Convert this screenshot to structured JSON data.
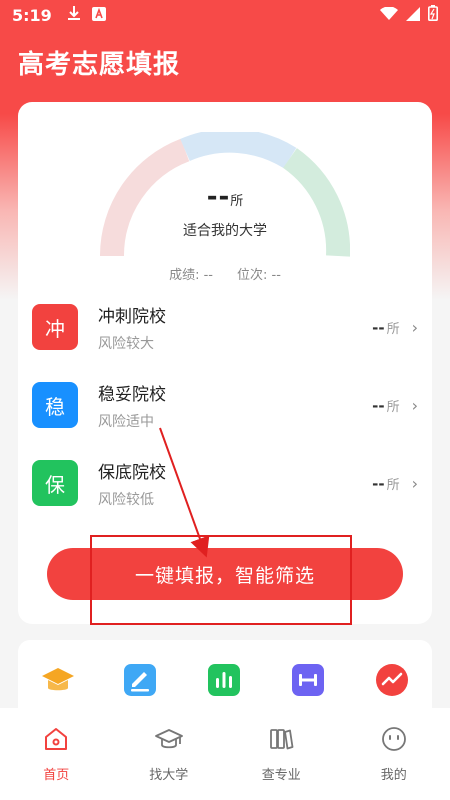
{
  "status": {
    "time": "5:19"
  },
  "app": {
    "title": "高考志愿填报"
  },
  "gauge": {
    "count": "--",
    "unit": "所",
    "caption": "适合我的大学",
    "score_label": "成绩: --",
    "rank_label": "位次: --"
  },
  "categories": [
    {
      "char": "冲",
      "title": "冲刺院校",
      "subtitle": "风险较大",
      "count": "--",
      "unit": "所",
      "color": "#f2423f"
    },
    {
      "char": "稳",
      "title": "稳妥院校",
      "subtitle": "风险适中",
      "count": "--",
      "unit": "所",
      "color": "#1890ff"
    },
    {
      "char": "保",
      "title": "保底院校",
      "subtitle": "风险较低",
      "count": "--",
      "unit": "所",
      "color": "#22c35e"
    }
  ],
  "cta": {
    "label": "一键填报，智能筛选"
  },
  "tools": [
    {
      "icon": "graduation-cap-icon",
      "color": "#f5a623"
    },
    {
      "icon": "edit-icon",
      "color": "#3fa8f5"
    },
    {
      "icon": "bar-chart-icon",
      "color": "#22c35e"
    },
    {
      "icon": "ruler-icon",
      "color": "#6d63f2"
    },
    {
      "icon": "trend-icon",
      "color": "#f2423f"
    }
  ],
  "tabs": [
    {
      "label": "首页",
      "icon": "home-icon",
      "active": true
    },
    {
      "label": "找大学",
      "icon": "graduation-cap-icon",
      "active": false
    },
    {
      "label": "查专业",
      "icon": "books-icon",
      "active": false
    },
    {
      "label": "我的",
      "icon": "smiley-icon",
      "active": false
    }
  ],
  "colors": {
    "brand": "#f2423f",
    "gauge_red": "#f6dcdc",
    "gauge_blue": "#d6e7f6",
    "gauge_green": "#d3ecdd"
  }
}
